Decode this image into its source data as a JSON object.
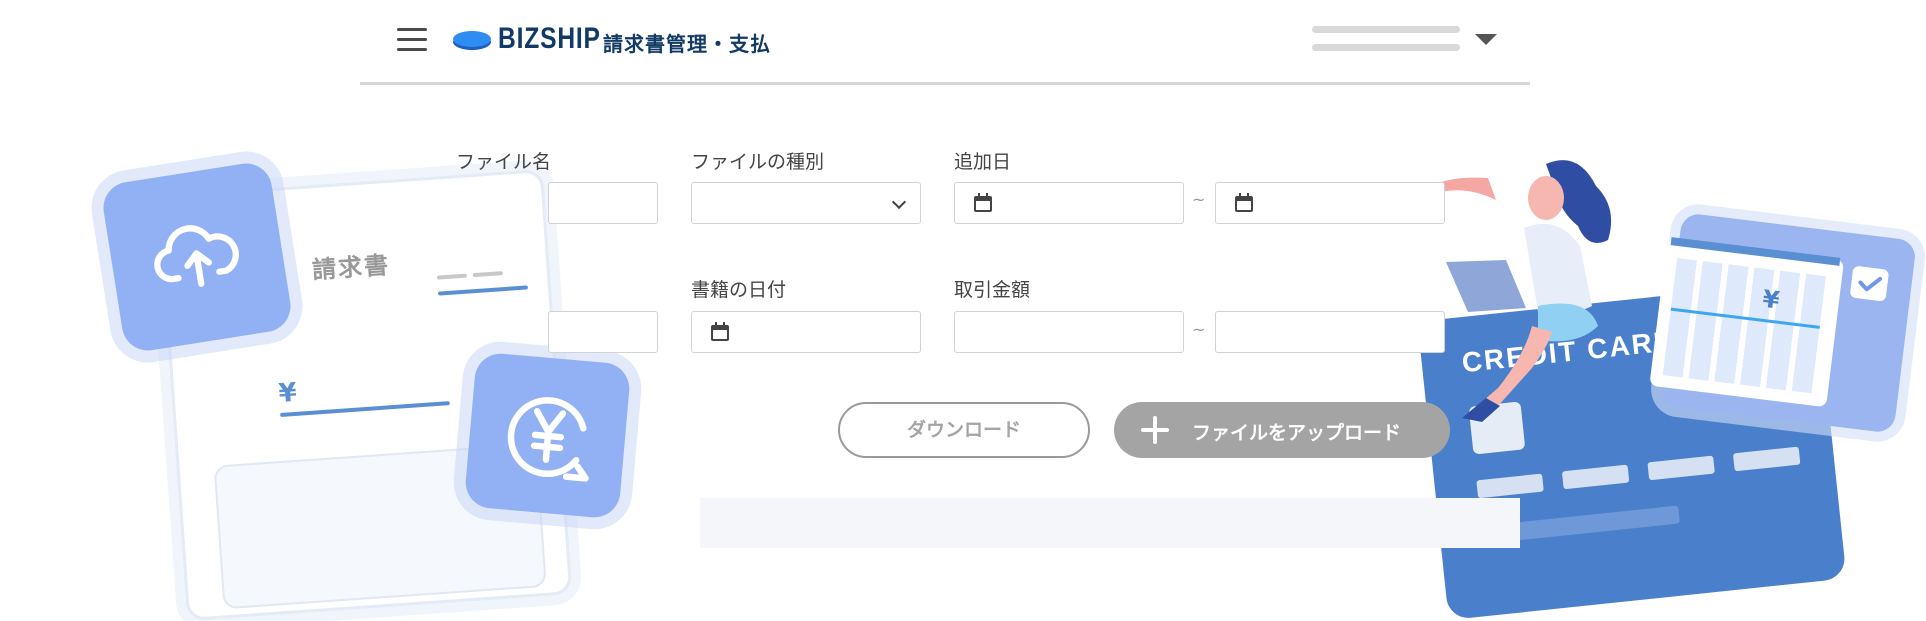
{
  "header": {
    "brand": "BIZSHIP",
    "subtitle": "請求書管理・支払"
  },
  "form": {
    "file_name_label": "ファイル名",
    "file_type_label": "ファイルの種別",
    "added_date_label": "追加日",
    "book_date_label": "書籍の日付",
    "amount_label": "取引金額",
    "range_separator": "~"
  },
  "buttons": {
    "download": "ダウンロード",
    "upload": "ファイルをアップロード"
  },
  "illustration": {
    "invoice_title": "請求書",
    "yen_symbol": "¥",
    "card_text": "CREDIT CARD"
  },
  "colors": {
    "brand": "#123a66",
    "accent": "#92b1f4",
    "card": "#4a7fcb",
    "button_grey": "#a4a4a4"
  },
  "icons": [
    "menu-icon",
    "logo-icon",
    "chevron-down-icon",
    "calendar-icon",
    "plus-icon",
    "cloud-upload-icon",
    "yen-refresh-icon",
    "check-icon"
  ]
}
